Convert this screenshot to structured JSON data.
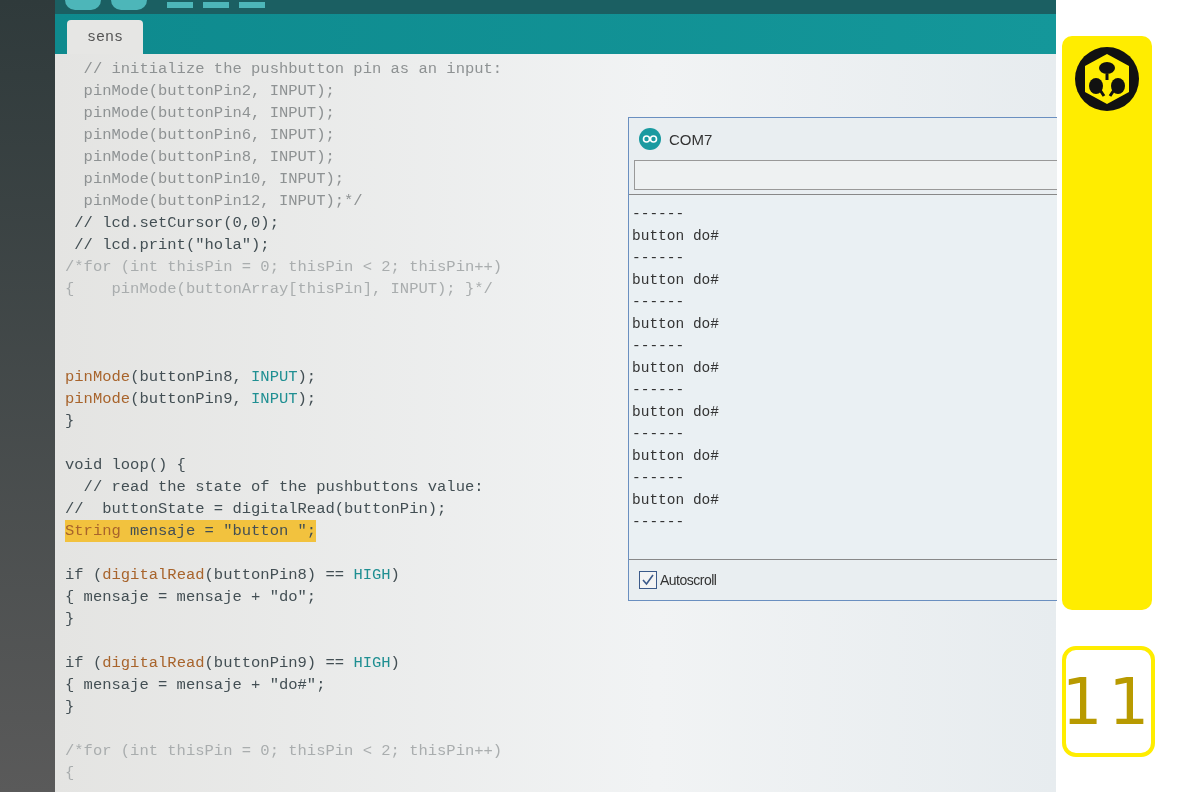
{
  "editor": {
    "tabs": [
      {
        "label": "sens",
        "selected": true
      }
    ],
    "lines": [
      {
        "kind": "code",
        "segments": [
          {
            "text": "  // initialize the pushbutton pin as an input:",
            "kind": "dim"
          }
        ]
      },
      {
        "kind": "code",
        "segments": [
          {
            "text": "  pinMode(buttonPin2, INPUT);",
            "kind": "dim"
          }
        ]
      },
      {
        "kind": "code",
        "segments": [
          {
            "text": "  pinMode(buttonPin4, INPUT);",
            "kind": "dim"
          }
        ]
      },
      {
        "kind": "code",
        "segments": [
          {
            "text": "  pinMode(buttonPin6, INPUT);",
            "kind": "dim"
          }
        ]
      },
      {
        "kind": "code",
        "segments": [
          {
            "text": "  pinMode(buttonPin8, INPUT);",
            "kind": "dim"
          }
        ]
      },
      {
        "kind": "code",
        "segments": [
          {
            "text": "  pinMode(buttonPin10, INPUT);",
            "kind": "dim"
          }
        ]
      },
      {
        "kind": "code",
        "segments": [
          {
            "text": "  pinMode(buttonPin12, INPUT);*/",
            "kind": "dim"
          }
        ]
      },
      {
        "kind": "code",
        "segments": [
          {
            "text": " // lcd.setCursor(0,0);",
            "kind": "code"
          }
        ]
      },
      {
        "kind": "code",
        "segments": [
          {
            "text": " // lcd.print(\"hola\");",
            "kind": "code"
          }
        ]
      },
      {
        "kind": "code",
        "segments": [
          {
            "text": "/*for (int thisPin = 0; thisPin < 2; thisPin++)",
            "kind": "comment"
          }
        ]
      },
      {
        "kind": "code",
        "segments": [
          {
            "text": "{    pinMode(buttonArray[thisPin], INPUT); }*/",
            "kind": "comment"
          }
        ]
      },
      {
        "kind": "blank"
      },
      {
        "kind": "blank"
      },
      {
        "kind": "blank"
      },
      {
        "kind": "code",
        "segments": [
          {
            "text": "pinMode",
            "kind": "function"
          },
          {
            "text": "(buttonPin8, ",
            "kind": "code"
          },
          {
            "text": "INPUT",
            "kind": "constant"
          },
          {
            "text": ");",
            "kind": "code"
          }
        ]
      },
      {
        "kind": "code",
        "segments": [
          {
            "text": "pinMode",
            "kind": "function"
          },
          {
            "text": "(buttonPin9, ",
            "kind": "code"
          },
          {
            "text": "INPUT",
            "kind": "constant"
          },
          {
            "text": ");",
            "kind": "code"
          }
        ]
      },
      {
        "kind": "code",
        "segments": [
          {
            "text": "}",
            "kind": "code"
          }
        ]
      },
      {
        "kind": "blank"
      },
      {
        "kind": "code",
        "segments": [
          {
            "text": "void loop() {",
            "kind": "code"
          }
        ]
      },
      {
        "kind": "code",
        "segments": [
          {
            "text": "  // read the state of the pushbuttons value:",
            "kind": "code"
          }
        ]
      },
      {
        "kind": "code",
        "segments": [
          {
            "text": "//  buttonState = digitalRead(buttonPin);",
            "kind": "code"
          }
        ]
      },
      {
        "kind": "code",
        "highlighted": true,
        "segments": [
          {
            "text": "String",
            "kind": "function"
          },
          {
            "text": " mensaje = \"button \";",
            "kind": "code"
          }
        ]
      },
      {
        "kind": "blank"
      },
      {
        "kind": "code",
        "segments": [
          {
            "text": "if (",
            "kind": "code"
          },
          {
            "text": "digitalRead",
            "kind": "function"
          },
          {
            "text": "(buttonPin8) == ",
            "kind": "code"
          },
          {
            "text": "HIGH",
            "kind": "constant"
          },
          {
            "text": ")",
            "kind": "code"
          }
        ]
      },
      {
        "kind": "code",
        "segments": [
          {
            "text": "{ mensaje = mensaje + \"do\";",
            "kind": "code"
          }
        ]
      },
      {
        "kind": "code",
        "segments": [
          {
            "text": "}",
            "kind": "code"
          }
        ]
      },
      {
        "kind": "blank"
      },
      {
        "kind": "code",
        "segments": [
          {
            "text": "if (",
            "kind": "code"
          },
          {
            "text": "digitalRead",
            "kind": "function"
          },
          {
            "text": "(buttonPin9) == ",
            "kind": "code"
          },
          {
            "text": "HIGH",
            "kind": "constant"
          },
          {
            "text": ")",
            "kind": "code"
          }
        ]
      },
      {
        "kind": "code",
        "segments": [
          {
            "text": "{ mensaje = mensaje + \"do#\";",
            "kind": "code"
          }
        ]
      },
      {
        "kind": "code",
        "segments": [
          {
            "text": "}",
            "kind": "code"
          }
        ]
      },
      {
        "kind": "blank"
      },
      {
        "kind": "code",
        "segments": [
          {
            "text": "/*for (int thisPin = 0; thisPin < 2; thisPin++)",
            "kind": "comment"
          }
        ]
      },
      {
        "kind": "code",
        "segments": [
          {
            "text": "{",
            "kind": "comment"
          }
        ]
      }
    ]
  },
  "serial_monitor": {
    "title": "COM7",
    "output": [
      "------",
      "button do#",
      "------",
      "button do#",
      "------",
      "button do#",
      "------",
      "button do#",
      "------",
      "button do#",
      "------",
      "button do#",
      "------",
      "button do#",
      "------"
    ],
    "autoscroll": {
      "label": "Autoscroll",
      "checked": true
    }
  },
  "slide": {
    "page_number": "11"
  }
}
